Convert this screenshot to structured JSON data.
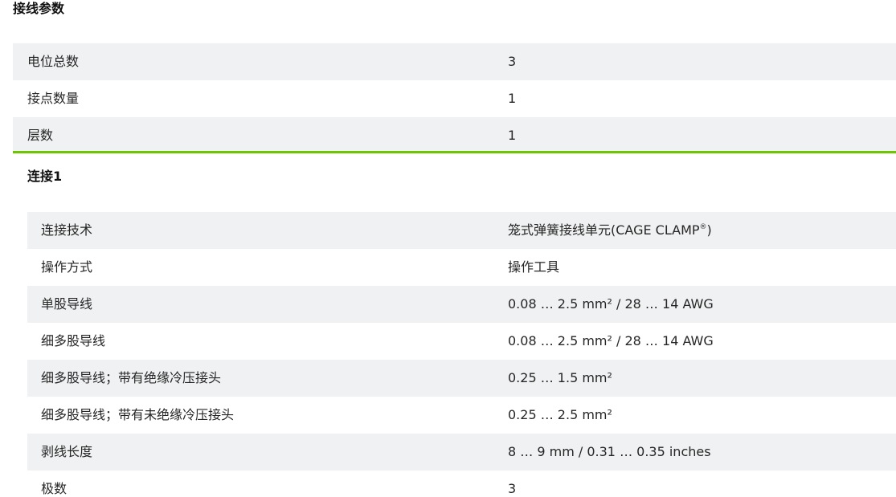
{
  "section": {
    "title": "接线参数",
    "rows": [
      {
        "label": "电位总数",
        "value": "3"
      },
      {
        "label": "接点数量",
        "value": "1"
      },
      {
        "label": "层数",
        "value": "1"
      }
    ]
  },
  "connection": {
    "title": "连接1",
    "rows": [
      {
        "label": "连接技术",
        "value": "笼式弹簧接线单元(CAGE CLAMP",
        "sup": "®",
        "suffix": ")"
      },
      {
        "label": "操作方式",
        "value": "操作工具"
      },
      {
        "label": "单股导线",
        "value": "0.08 … 2.5 mm² / 28 … 14 AWG"
      },
      {
        "label": "细多股导线",
        "value": "0.08 … 2.5 mm² / 28 … 14 AWG"
      },
      {
        "label": "细多股导线；带有绝缘冷压接头",
        "value": "0.25 … 1.5 mm²"
      },
      {
        "label": "细多股导线；带有未绝缘冷压接头",
        "value": "0.25 … 2.5 mm²"
      },
      {
        "label": "剥线长度",
        "value": "8 … 9 mm / 0.31 … 0.35 inches"
      },
      {
        "label": "极数",
        "value": "3"
      }
    ]
  },
  "colors": {
    "accent": "#6ec400",
    "row_shade": "#f0f1f2"
  }
}
